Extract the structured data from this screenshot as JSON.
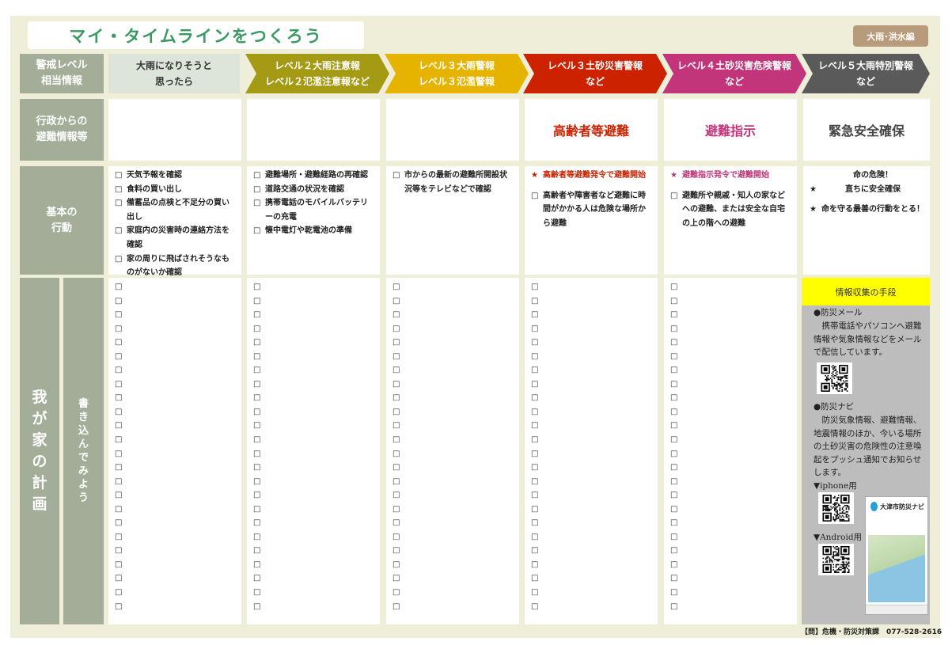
{
  "title": "マイ・タイムラインをつくろう",
  "badge": "大雨･洪水編",
  "row_labels": {
    "level": "警戒レベル\n相当情報",
    "evacuation": "行政からの\n避難情報等",
    "action": "基本の\n行動",
    "plan_main": [
      "我",
      "が",
      "家",
      "の",
      "計",
      "画"
    ],
    "plan_sub": [
      "書",
      "き",
      "込",
      "ん",
      "で",
      "み",
      "よ",
      "う"
    ]
  },
  "columns": [
    {
      "header": "大雨になりそうと\n思ったら",
      "color": "#dde5db",
      "text_color": "#333333",
      "evacuation": "",
      "evacuation_color": "#222222",
      "actions": [
        {
          "mark": "□",
          "text": "天気予報を確認"
        },
        {
          "mark": "□",
          "text": "食料の買い出し"
        },
        {
          "mark": "□",
          "text": "備蓄品の点検と不足分の買い出し"
        },
        {
          "mark": "□",
          "text": "家庭内の災害時の連絡方法を確認"
        },
        {
          "mark": "□",
          "text": "家の周りに飛ばされそうなものがないか確認"
        }
      ]
    },
    {
      "header": "レベル２大雨注意報\nレベル２氾濫注意報など",
      "color": "#a49a13",
      "text_color": "#ffffff",
      "evacuation": "",
      "evacuation_color": "#222222",
      "actions": [
        {
          "mark": "□",
          "text": "避難場所・避難経路の再確認"
        },
        {
          "mark": "□",
          "text": "道路交通の状況を確認"
        },
        {
          "mark": "□",
          "text": "携帯電話のモバイルバッテリーの充電"
        },
        {
          "mark": "□",
          "text": "懐中電灯や乾電池の準備"
        }
      ]
    },
    {
      "header": "レベル３大雨警報\nレベル３氾濫警報",
      "color": "#e6b400",
      "text_color": "#ffffff",
      "evacuation": "",
      "evacuation_color": "#222222",
      "actions": [
        {
          "mark": "□",
          "text": "市からの最新の避難所開設状況等をテレビなどで確認"
        }
      ]
    },
    {
      "header": "レベル３土砂災害警報\nなど",
      "color": "#cc2200",
      "text_color": "#ffffff",
      "evacuation": "高齢者等避難",
      "evacuation_color": "#cc2200",
      "actions": [
        {
          "mark": "★",
          "text": "高齢者等避難発令で避難開始",
          "style": "red"
        },
        {
          "mark": "□",
          "text": "高齢者や障害者など避難に時間がかかる人は危険な場所から避難"
        }
      ]
    },
    {
      "header": "レベル４土砂災害危険警報\nなど",
      "color": "#c2357a",
      "text_color": "#ffffff",
      "evacuation": "避難指示",
      "evacuation_color": "#c2357a",
      "actions": [
        {
          "mark": "★",
          "text": "避難指示発令で避難開始",
          "style": "mag"
        },
        {
          "mark": "□",
          "text": "避難所や親戚・知人の家などへの避難、または安全な自宅の上の階への避難"
        }
      ]
    },
    {
      "header": "レベル５大雨特別警報\nなど",
      "color": "#5a5a5a",
      "text_color": "#ffffff",
      "evacuation": "緊急安全確保",
      "evacuation_color": "#444444",
      "actions": [
        {
          "mark": "★",
          "text": "命の危険！\n直ちに安全確保",
          "style": "center"
        },
        {
          "mark": "★",
          "text": "命を守る最善の行動をとる！"
        }
      ]
    }
  ],
  "checkbox_mark": "□",
  "plan_rows": 24,
  "info_panel": {
    "heading": "情報収集の手段",
    "mail_title": "●防災メール",
    "mail_text": "　携帯電話やパソコンへ避難情報や気象情報などをメールで配信しています。",
    "navi_title": "●防災ナビ",
    "navi_text": "　防災気象情報、避難情報、地震情報のほか、今いる場所の土砂災害の危険性の注意喚起をプッシュ通知でお知らせします。",
    "iphone_label": "▼iphone用",
    "android_label": "▼Android用",
    "app_name": "大津市防災ナビ"
  },
  "footer": "【問】危機・防災対策課　077-528-2616"
}
